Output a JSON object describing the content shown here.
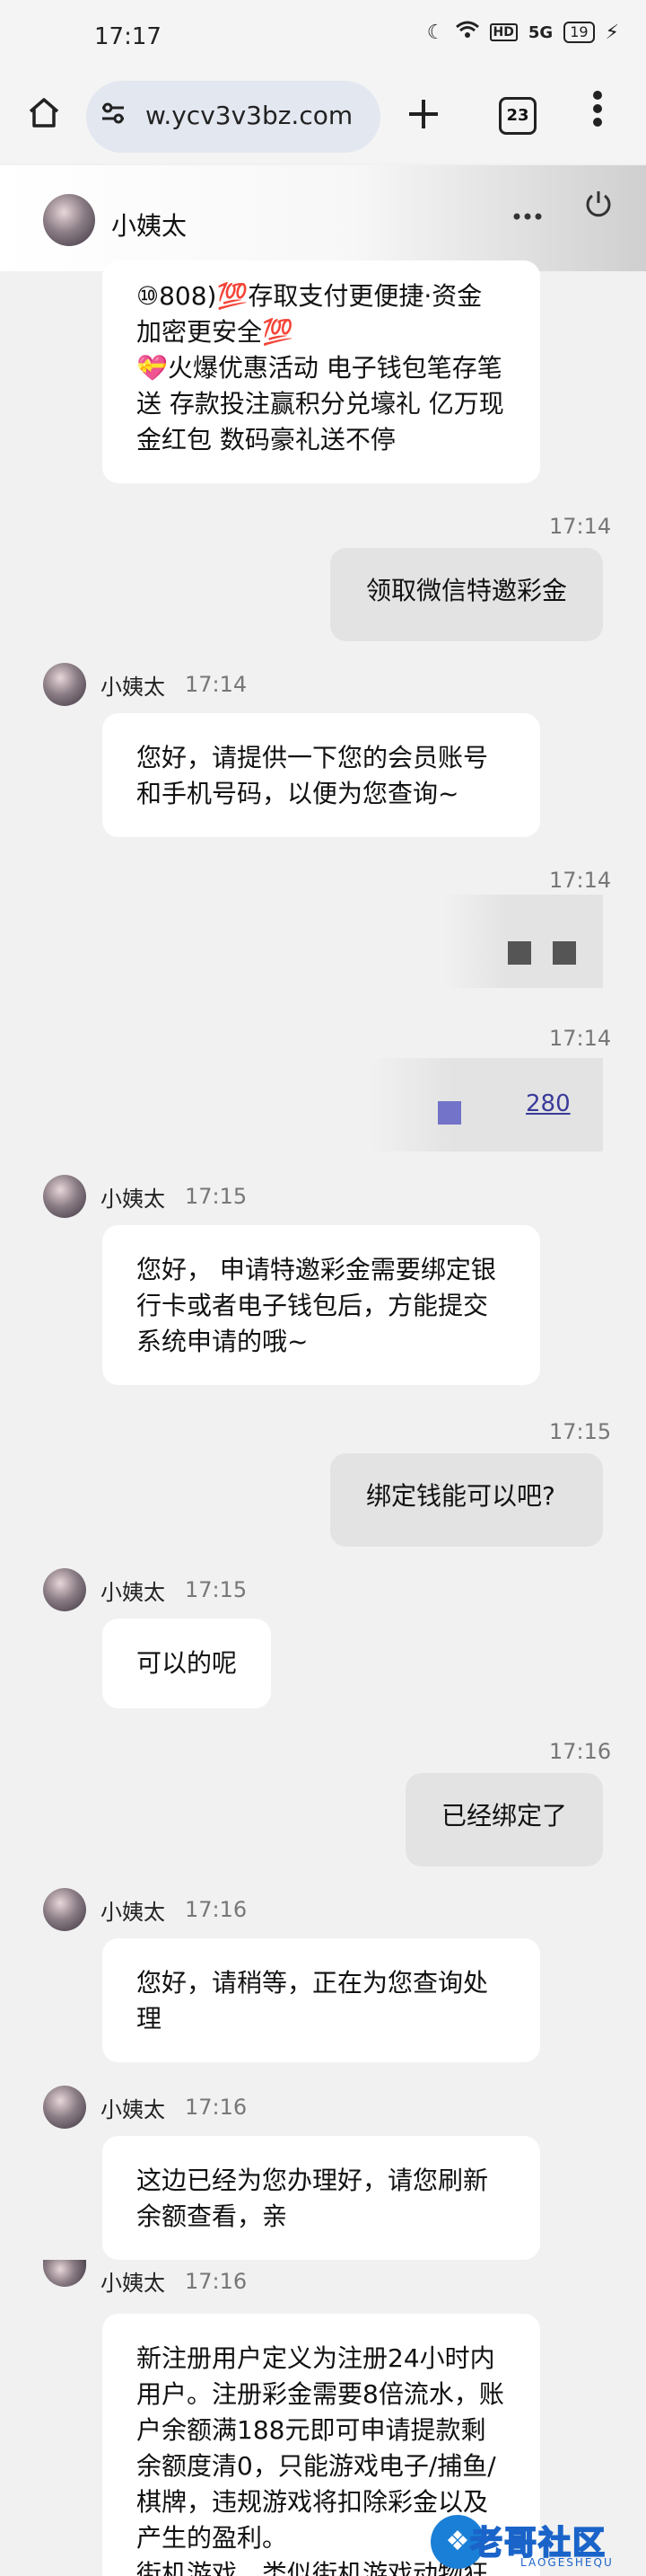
{
  "status_bar": {
    "time": "17:17",
    "battery": "19",
    "icons": [
      "moon-icon",
      "wifi-icon",
      "hd-icon",
      "5g-icon",
      "battery-icon",
      "charging-icon"
    ]
  },
  "browser": {
    "url": "w.ycv3v3bz.com",
    "tab_count": "23"
  },
  "chat": {
    "contact_name": "小姨太",
    "messages": [
      {
        "type": "in",
        "text": "⑩808)💯存取支付更便捷·资金加密更安全💯\n💝火爆优惠活动 电子钱包笔存笔送 存款投注赢积分兑壕礼 亿万现金红包 数码豪礼送不停"
      },
      {
        "type": "out",
        "time": "17:14",
        "text": "领取微信特邀彩金"
      },
      {
        "type": "in",
        "sender": "小姨太",
        "time": "17:14",
        "text": "您好，请提供一下您的会员账号和手机号码，以便为您查询~"
      },
      {
        "type": "out",
        "time": "17:14",
        "text": ""
      },
      {
        "type": "out",
        "time": "17:14",
        "text": "280"
      },
      {
        "type": "in",
        "sender": "小姨太",
        "time": "17:15",
        "text": "您好， 申请特邀彩金需要绑定银行卡或者电子钱包后，方能提交系统申请的哦~"
      },
      {
        "type": "out",
        "time": "17:15",
        "text": "绑定钱能可以吧?"
      },
      {
        "type": "in",
        "sender": "小姨太",
        "time": "17:15",
        "text": "可以的呢"
      },
      {
        "type": "out",
        "time": "17:16",
        "text": "已经绑定了"
      },
      {
        "type": "in",
        "sender": "小姨太",
        "time": "17:16",
        "text": "您好，请稍等，正在为您查询处理"
      },
      {
        "type": "in",
        "sender": "小姨太",
        "time": "17:16",
        "text": "这边已经为您办理好，请您刷新余额查看，亲"
      },
      {
        "type": "in",
        "sender": "小姨太",
        "time": "17:16",
        "text": "新注册用户定义为注册24小时内用户。注册彩金需要8倍流水，账户余额满188元即可申请提款剩余额度清0，只能游戏电子/捕鱼/棋牌，违规游戏将扣除彩金以及产生的盈利。\n街机游戏，类似街机游戏动物狂"
      }
    ]
  },
  "watermark": {
    "main": "老哥社区",
    "sub": "LAOGESHEQU"
  }
}
